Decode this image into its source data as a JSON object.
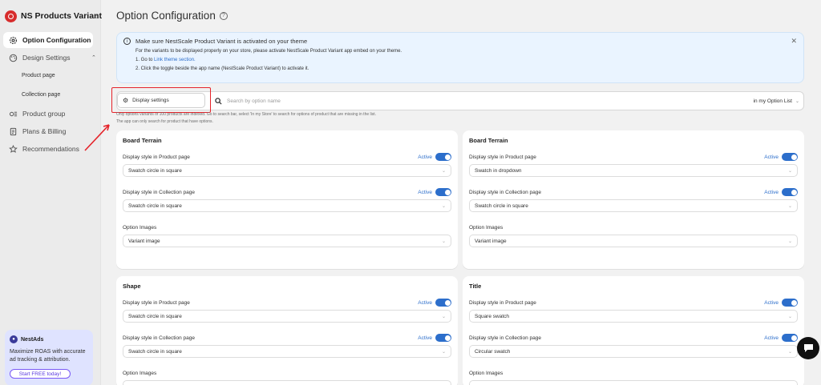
{
  "app": {
    "name": "NS Products Variant",
    "collapse_icon": "chevron-left-icon"
  },
  "sidebar": {
    "items": [
      {
        "label": "Option Configuration",
        "icon": "gear-icon",
        "active": true
      },
      {
        "label": "Design Settings",
        "icon": "palette-icon",
        "expanded": true
      },
      {
        "label": "Product page",
        "sub": true
      },
      {
        "label": "Collection page",
        "sub": true
      },
      {
        "label": "Product group",
        "icon": "group-icon"
      },
      {
        "label": "Plans & Billing",
        "icon": "receipt-icon"
      },
      {
        "label": "Recommendations",
        "icon": "star-icon"
      }
    ],
    "promo": {
      "brand": "NestAds",
      "text": "Maximize ROAS with accurate ad tracking & attribution.",
      "button": "Start FREE today!"
    }
  },
  "page": {
    "title": "Option Configuration"
  },
  "banner": {
    "title": "Make sure NestScale Product Variant is activated on your theme",
    "line1": "For the variants to be displayed properly on your store, please activate NestScale Product Variant app embed on your theme.",
    "step1_prefix": "1. Go to ",
    "step1_link": "Link theme section.",
    "step2": "2. Click the toggle beside the app name (NestScale Product Variant) to activate it."
  },
  "toolbar": {
    "display_settings": "Display settings",
    "search_placeholder": "Search by option name",
    "filter_value": "in my Option List"
  },
  "hints": {
    "line1": "Only options variants of 100 products are indexed. Go to search bar, select 'In my Store' to search for options of product that are missing in the list.",
    "line2": "The app can only search for product that have options."
  },
  "labels": {
    "product_page": "Display style in Product page",
    "collection_page": "Display style in Collection page",
    "option_images": "Option Images",
    "active": "Active"
  },
  "cards": [
    {
      "title": "Board Terrain",
      "product_style": "Swatch circle in square",
      "collection_style": "Swatch circle in square",
      "images": "Variant image"
    },
    {
      "title": "Board Terrain",
      "product_style": "Swatch in dropdown",
      "collection_style": "Swatch circle in square",
      "images": "Variant image"
    },
    {
      "title": "Shape",
      "product_style": "Swatch circle in square",
      "collection_style": "Swatch circle in square",
      "images": ""
    },
    {
      "title": "Title",
      "product_style": "Square swatch",
      "collection_style": "Circular swatch",
      "images": ""
    }
  ],
  "colors": {
    "accent": "#2c6ecb",
    "highlight": "#e5232a",
    "brand": "#d72c2c"
  }
}
